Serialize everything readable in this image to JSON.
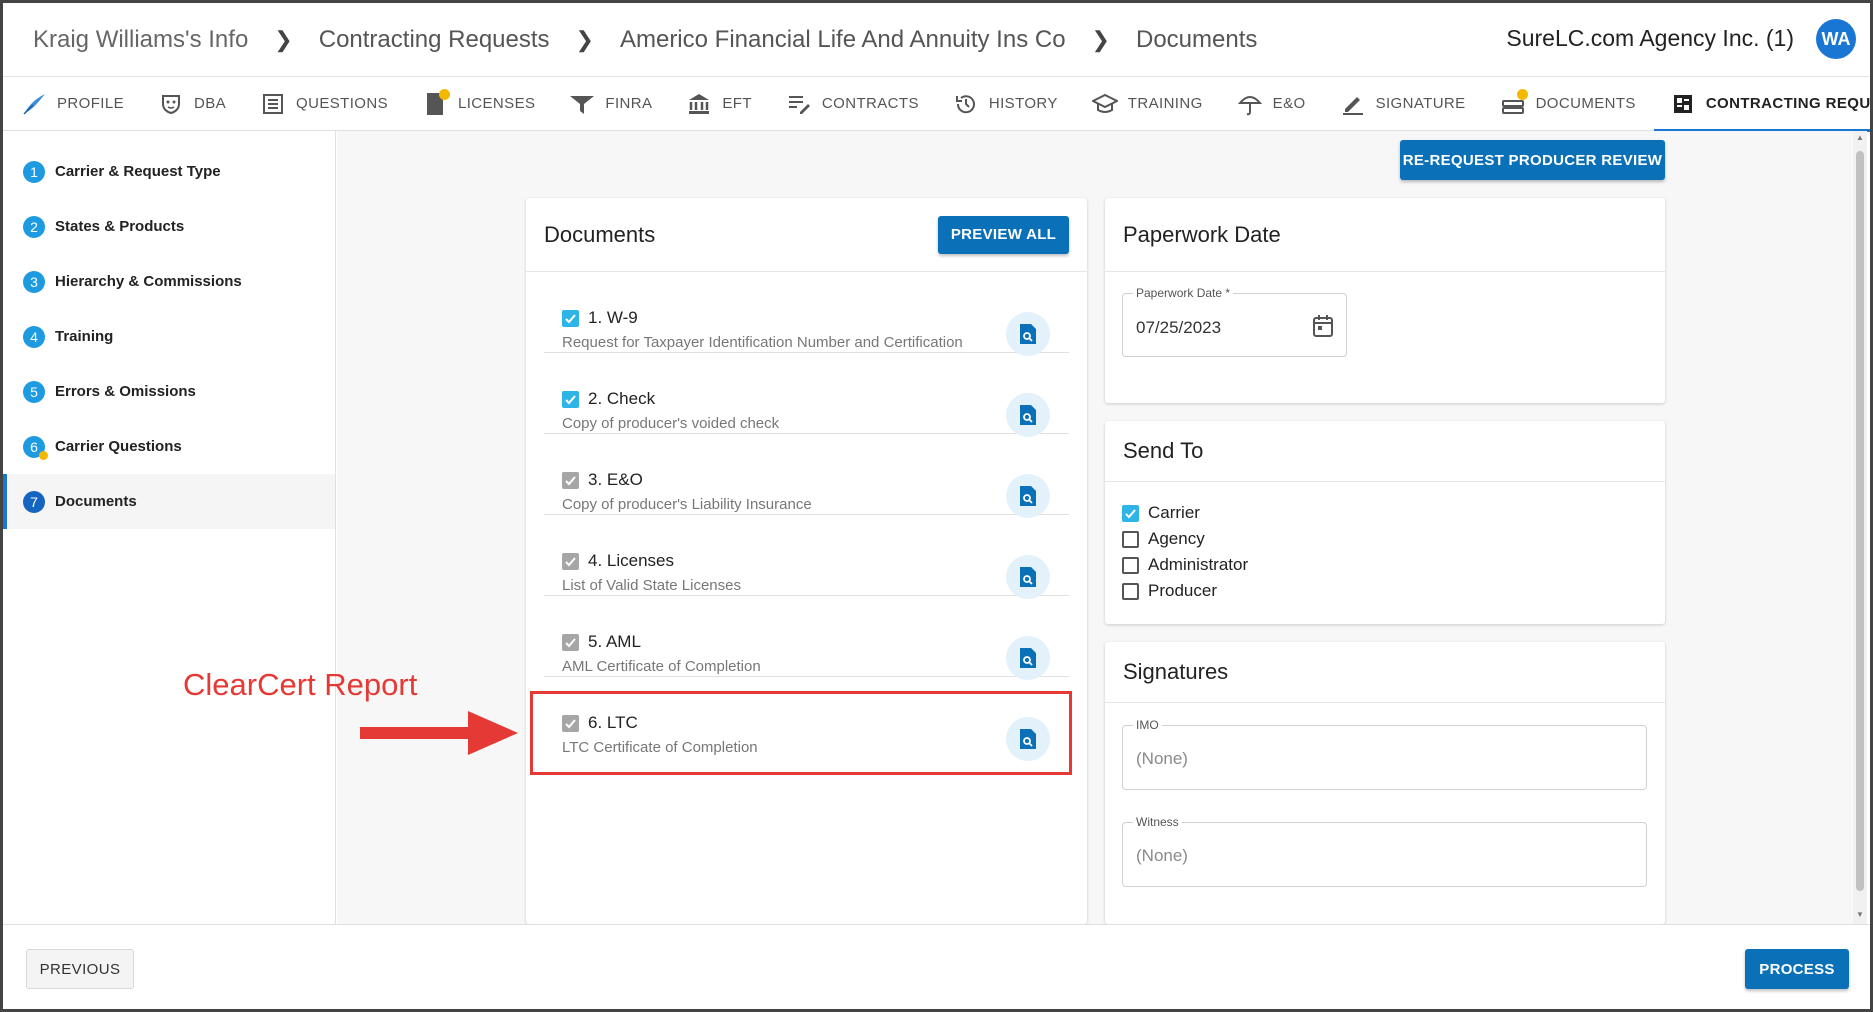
{
  "breadcrumbs": [
    "Kraig Williams's Info",
    "Contracting Requests",
    "Americo Financial Life And Annuity Ins Co",
    "Documents"
  ],
  "agency": "SureLC.com Agency Inc. (1)",
  "avatar": "WA",
  "tabs": [
    {
      "label": "PROFILE",
      "icon": "feather-icon"
    },
    {
      "label": "DBA",
      "icon": "mask-icon"
    },
    {
      "label": "QUESTIONS",
      "icon": "list-icon"
    },
    {
      "label": "LICENSES",
      "icon": "license-icon",
      "badge": true
    },
    {
      "label": "FINRA",
      "icon": "finra-icon"
    },
    {
      "label": "EFT",
      "icon": "bank-icon"
    },
    {
      "label": "CONTRACTS",
      "icon": "edit-list-icon"
    },
    {
      "label": "HISTORY",
      "icon": "history-icon"
    },
    {
      "label": "TRAINING",
      "icon": "graduation-cap-icon"
    },
    {
      "label": "E&O",
      "icon": "umbrella-icon"
    },
    {
      "label": "SIGNATURE",
      "icon": "pen-icon"
    },
    {
      "label": "DOCUMENTS",
      "icon": "documents-icon",
      "badge": true
    },
    {
      "label": "CONTRACTING REQUESTS",
      "icon": "requests-icon",
      "active": true
    }
  ],
  "steps": [
    {
      "num": "1",
      "label": "Carrier & Request Type"
    },
    {
      "num": "2",
      "label": "States & Products"
    },
    {
      "num": "3",
      "label": "Hierarchy & Commissions"
    },
    {
      "num": "4",
      "label": "Training"
    },
    {
      "num": "5",
      "label": "Errors & Omissions"
    },
    {
      "num": "6",
      "label": "Carrier Questions",
      "warning": true
    },
    {
      "num": "7",
      "label": "Documents",
      "active": true
    }
  ],
  "rerequest_label": "RE-REQUEST PRODUCER REVIEW",
  "documents": {
    "title": "Documents",
    "preview_all": "PREVIEW ALL",
    "items": [
      {
        "title": "1. W-9",
        "subtitle": "Request for Taxpayer Identification Number and Certification",
        "state": "checked"
      },
      {
        "title": "2. Check",
        "subtitle": "Copy of producer's voided check",
        "state": "checked"
      },
      {
        "title": "3. E&O",
        "subtitle": "Copy of producer's Liability Insurance",
        "state": "disabled"
      },
      {
        "title": "4. Licenses",
        "subtitle": "List of Valid State Licenses",
        "state": "disabled"
      },
      {
        "title": "5. AML",
        "subtitle": "AML Certificate of Completion",
        "state": "disabled"
      },
      {
        "title": "6. LTC",
        "subtitle": "LTC Certificate of Completion",
        "state": "disabled"
      }
    ]
  },
  "annotation": "ClearCert Report",
  "paperwork": {
    "title": "Paperwork Date",
    "label": "Paperwork Date *",
    "value": "07/25/2023"
  },
  "send_to": {
    "title": "Send To",
    "options": [
      {
        "label": "Carrier",
        "checked": true
      },
      {
        "label": "Agency",
        "checked": false
      },
      {
        "label": "Administrator",
        "checked": false
      },
      {
        "label": "Producer",
        "checked": false
      }
    ]
  },
  "signatures": {
    "title": "Signatures",
    "imo_label": "IMO",
    "imo_value": "(None)",
    "witness_label": "Witness",
    "witness_value": "(None)"
  },
  "footer": {
    "previous": "PREVIOUS",
    "process": "PROCESS"
  },
  "colors": {
    "primary": "#0a70b8",
    "accent": "#1976d2",
    "check": "#2eb5e8",
    "annotation": "#e53935",
    "badge": "#f5b800"
  }
}
